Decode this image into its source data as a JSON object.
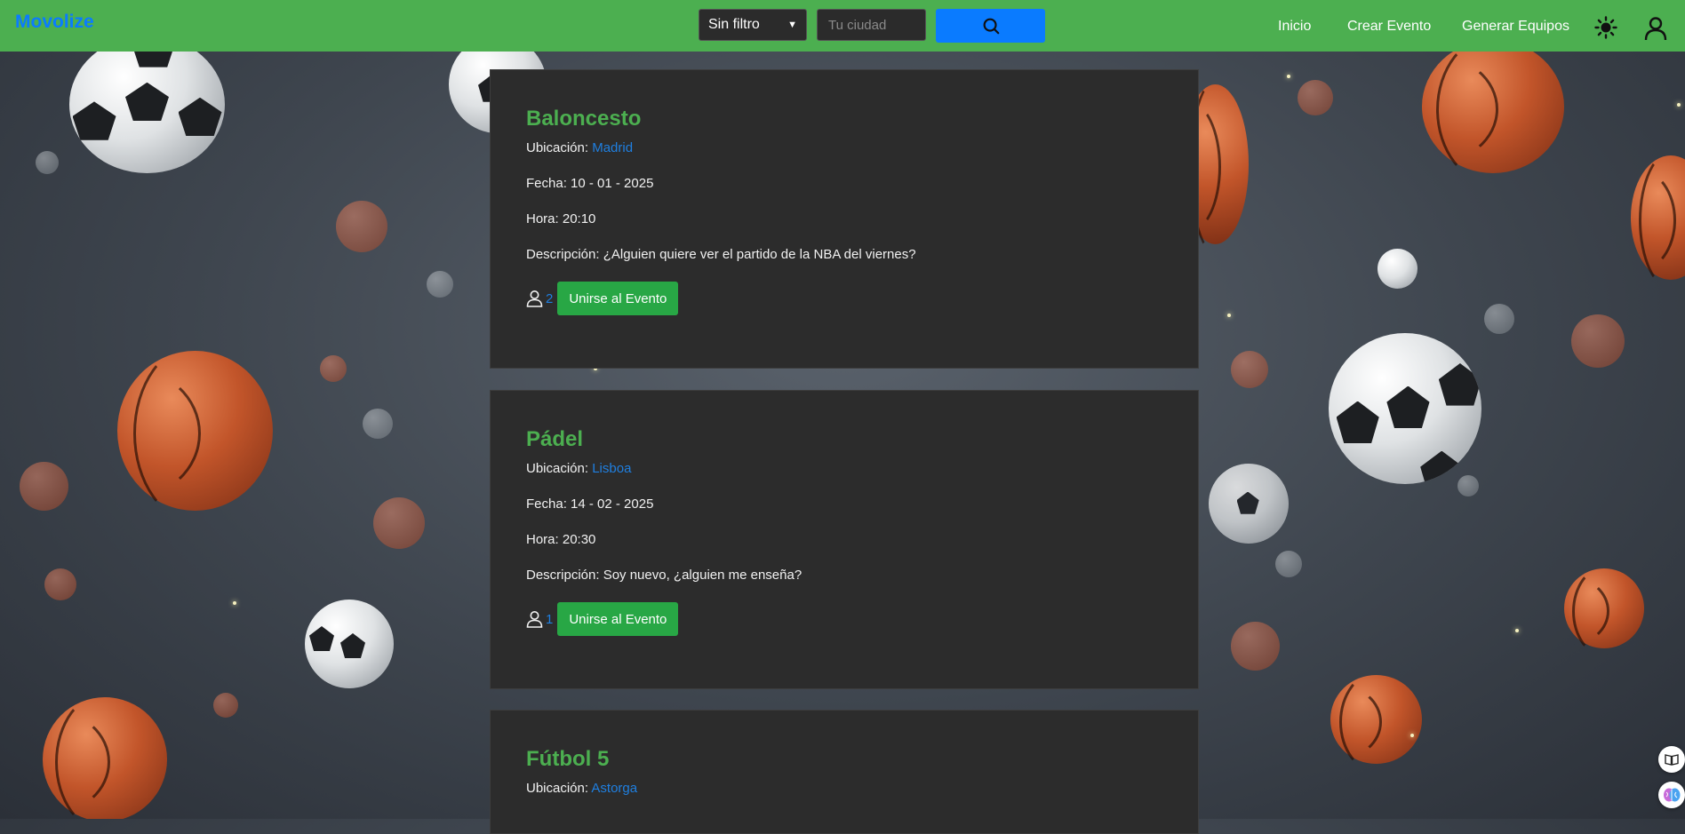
{
  "brand": "Movolize",
  "search": {
    "filter_selected": "Sin filtro",
    "city_placeholder": "Tu ciudad"
  },
  "nav": {
    "home": "Inicio",
    "create_event": "Crear Evento",
    "generate_teams": "Generar Equipos"
  },
  "events": [
    {
      "title": "Baloncesto",
      "location_label": "Ubicación:",
      "location": "Madrid",
      "date": "Fecha: 10 - 01 - 2025",
      "time": "Hora: 20:10",
      "description": "Descripción: ¿Alguien quiere ver el partido de la NBA del viernes?",
      "participants": "2",
      "join_label": "Unirse al Evento"
    },
    {
      "title": "Pádel",
      "location_label": "Ubicación:",
      "location": "Lisboa",
      "date": "Fecha: 14 - 02 - 2025",
      "time": "Hora: 20:30",
      "description": "Descripción: Soy nuevo, ¿alguien me enseña?",
      "participants": "1",
      "join_label": "Unirse al Evento"
    },
    {
      "title": "Fútbol 5",
      "location_label": "Ubicación:",
      "location": "Astorga"
    }
  ],
  "colors": {
    "navbar": "#4caf50",
    "brand": "#0a7bff",
    "card_bg": "#2c2c2c",
    "title": "#4caf50",
    "link": "#1f7fe0",
    "join_button": "#28a745",
    "search_button": "#0a7bff"
  },
  "icons": {
    "search": "search-icon",
    "theme": "sun-icon",
    "user": "user-icon",
    "participants": "person-icon"
  }
}
